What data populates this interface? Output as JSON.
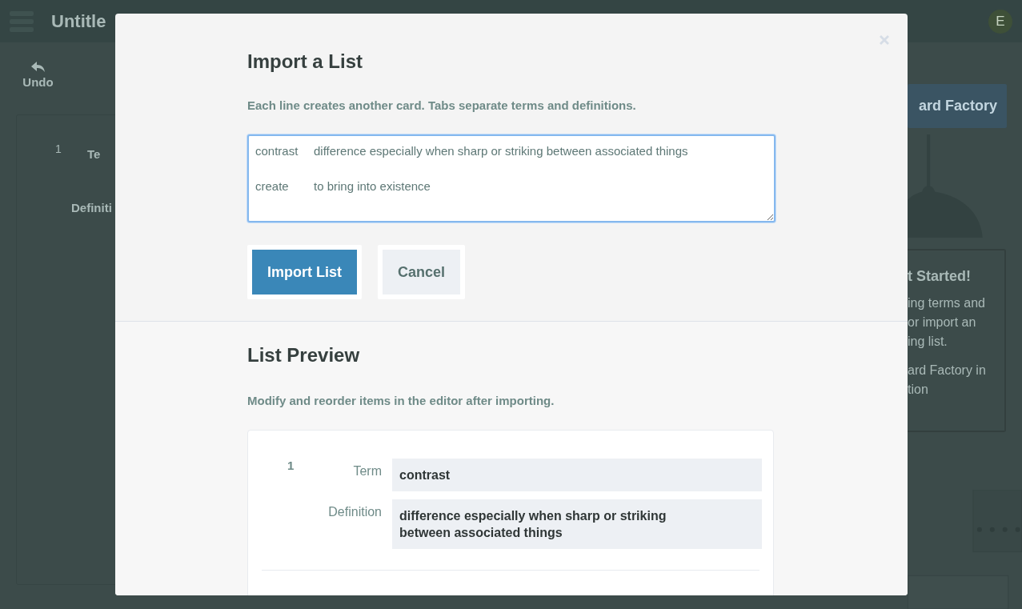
{
  "background": {
    "title": "Untitle",
    "avatar": "E",
    "undo_label": "Undo",
    "editor_rows": [
      {
        "number": "1",
        "term_label": "Te",
        "definition_label": "Definiti"
      }
    ],
    "factory_button": "ard Factory",
    "get_started": {
      "heading": "t Started!",
      "paragraphs": [
        [
          "ing terms and",
          "or import an",
          "ing list."
        ],
        [
          "ard Factory in",
          "tion"
        ]
      ]
    }
  },
  "modal": {
    "title": "Import a List",
    "instructions": "Each line creates another card. Tabs separate terms and definitions.",
    "textarea": {
      "value": "contrast\tdifference especially when sharp or striking between associated things\n\ncreate\tto bring into existence"
    },
    "buttons": [
      {
        "label": "Import List",
        "kind": "primary"
      },
      {
        "label": "Cancel",
        "kind": "secondary"
      }
    ],
    "preview": {
      "title": "List Preview",
      "hint": "Modify and reorder items in the editor after importing.",
      "items": [
        {
          "number": "1",
          "term_label": "Term",
          "term": "contrast",
          "definition_label": "Definition",
          "definition": "difference especially when sharp or striking between associated things"
        }
      ]
    }
  }
}
